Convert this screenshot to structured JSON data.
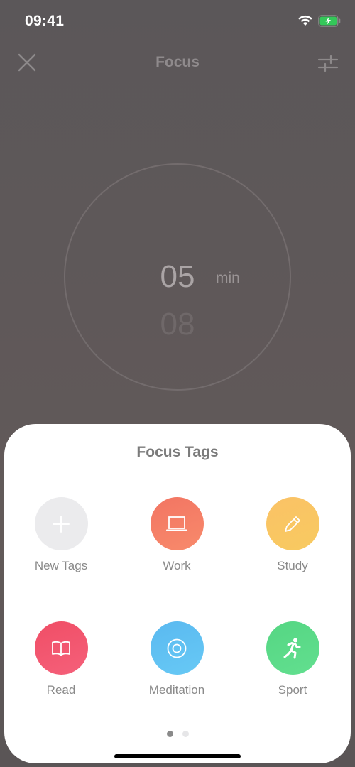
{
  "status_bar": {
    "time": "09:41",
    "icons": [
      "wifi-icon",
      "battery-charging-icon"
    ],
    "battery_color": "#34c759"
  },
  "nav": {
    "title": "Focus",
    "left_icon": "close-icon",
    "right_icon": "sliders-icon"
  },
  "timer": {
    "value": "05",
    "unit": "min",
    "next_value": "08"
  },
  "sheet": {
    "title": "Focus Tags",
    "tags": [
      {
        "label": "New Tags",
        "icon": "plus-icon",
        "color": "#ebebed"
      },
      {
        "label": "Work",
        "icon": "laptop-icon",
        "color": "#f57f66"
      },
      {
        "label": "Study",
        "icon": "pencil-icon",
        "color": "#fac763"
      },
      {
        "label": "Read",
        "icon": "book-icon",
        "color": "#f25369"
      },
      {
        "label": "Meditation",
        "icon": "target-icon",
        "color": "#5fc3f2"
      },
      {
        "label": "Sport",
        "icon": "running-icon",
        "color": "#5ad987"
      }
    ],
    "pagination": {
      "current": 1,
      "total": 2,
      "active_color": "#8a8a8a",
      "inactive_color": "#e6e6e8"
    }
  }
}
